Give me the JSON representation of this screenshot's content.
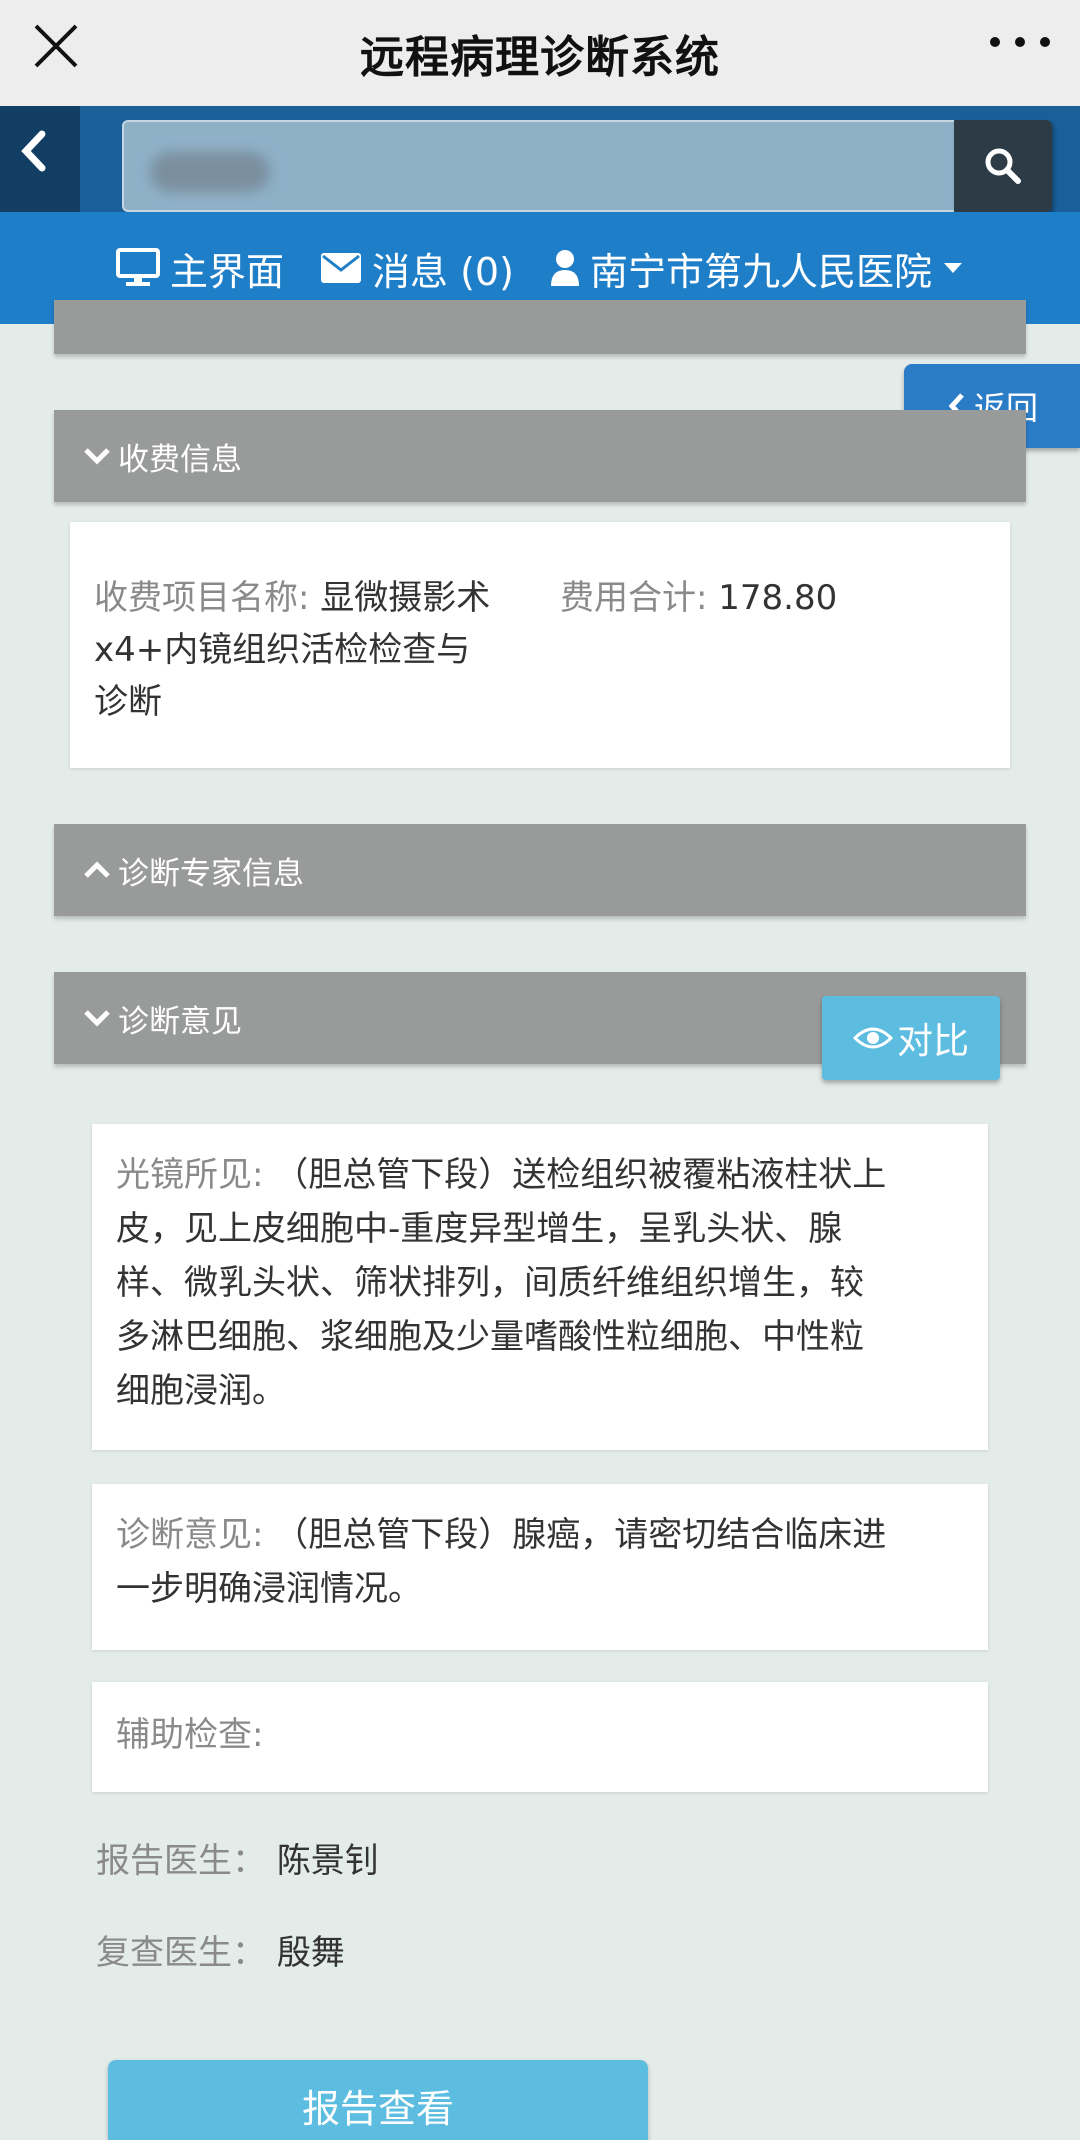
{
  "titlebar": {
    "title": "远程病理诊断系统"
  },
  "search": {
    "placeholder": ""
  },
  "nav": {
    "home": "主界面",
    "messages": "消息 (0)",
    "hospital": "南宁市第九人民医院"
  },
  "float": {
    "back": "返回",
    "compare": "对比"
  },
  "fee": {
    "header": "收费信息",
    "item_label": "收费项目名称:",
    "item_value_line1": "显微摄影术",
    "item_value_line2": "x4+内镜组织活检检查与",
    "item_value_line3": "诊断",
    "total_label": "费用合计:",
    "total_value": "178.80"
  },
  "expert": {
    "header": "诊断专家信息"
  },
  "opinion": {
    "header": "诊断意见",
    "micro_label": "光镜所见:",
    "micro_line1": "（胆总管下段）送检组织被覆粘液柱状上",
    "micro_line2": "皮，见上皮细胞中-重度异型增生，呈乳头状、腺",
    "micro_line3": "样、微乳头状、筛状排列，间质纤维组织增生，较",
    "micro_line4": "多淋巴细胞、浆细胞及少量嗜酸性粒细胞、中性粒",
    "micro_line5": "细胞浸润。",
    "diag_label": "诊断意见:",
    "diag_line1": "（胆总管下段）腺癌，请密切结合临床进",
    "diag_line2": "一步明确浸润情况。",
    "aux_label": "辅助检查:",
    "report_doctor_label": "报告医生：",
    "report_doctor": "陈景钊",
    "review_doctor_label": "复查医生：",
    "review_doctor": "殷舞",
    "view_report": "报告查看"
  }
}
